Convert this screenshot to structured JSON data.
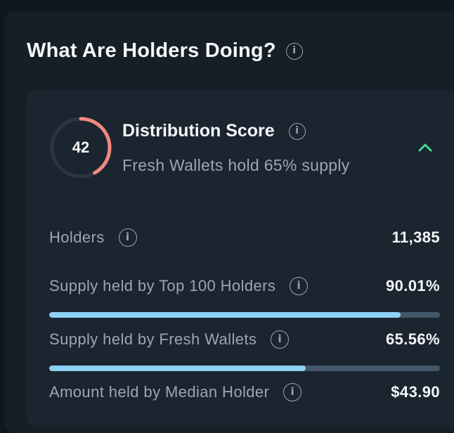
{
  "section": {
    "title": "What Are Holders Doing?",
    "info_icon": "info-icon"
  },
  "distribution": {
    "score": "42",
    "score_fraction": 0.42,
    "gauge_color": "#f08a7e",
    "gauge_track_color": "#2b3540",
    "title": "Distribution Score",
    "subtitle": "Fresh Wallets hold 65% supply",
    "expand_icon": "chevron-up-icon",
    "accent_color": "#3ddc97"
  },
  "metrics": {
    "holders": {
      "label": "Holders",
      "value": "11,385"
    },
    "top100": {
      "label": "Supply held by Top 100 Holders",
      "value": "90.01%",
      "fraction": 0.9001
    },
    "fresh_wallets": {
      "label": "Supply held by Fresh Wallets",
      "value": "65.56%",
      "fraction": 0.6556
    },
    "median_holder": {
      "label": "Amount held by Median Holder",
      "value": "$43.90"
    }
  },
  "colors": {
    "bar_fill": "#8dd1f4",
    "bar_track": "#44576a"
  }
}
